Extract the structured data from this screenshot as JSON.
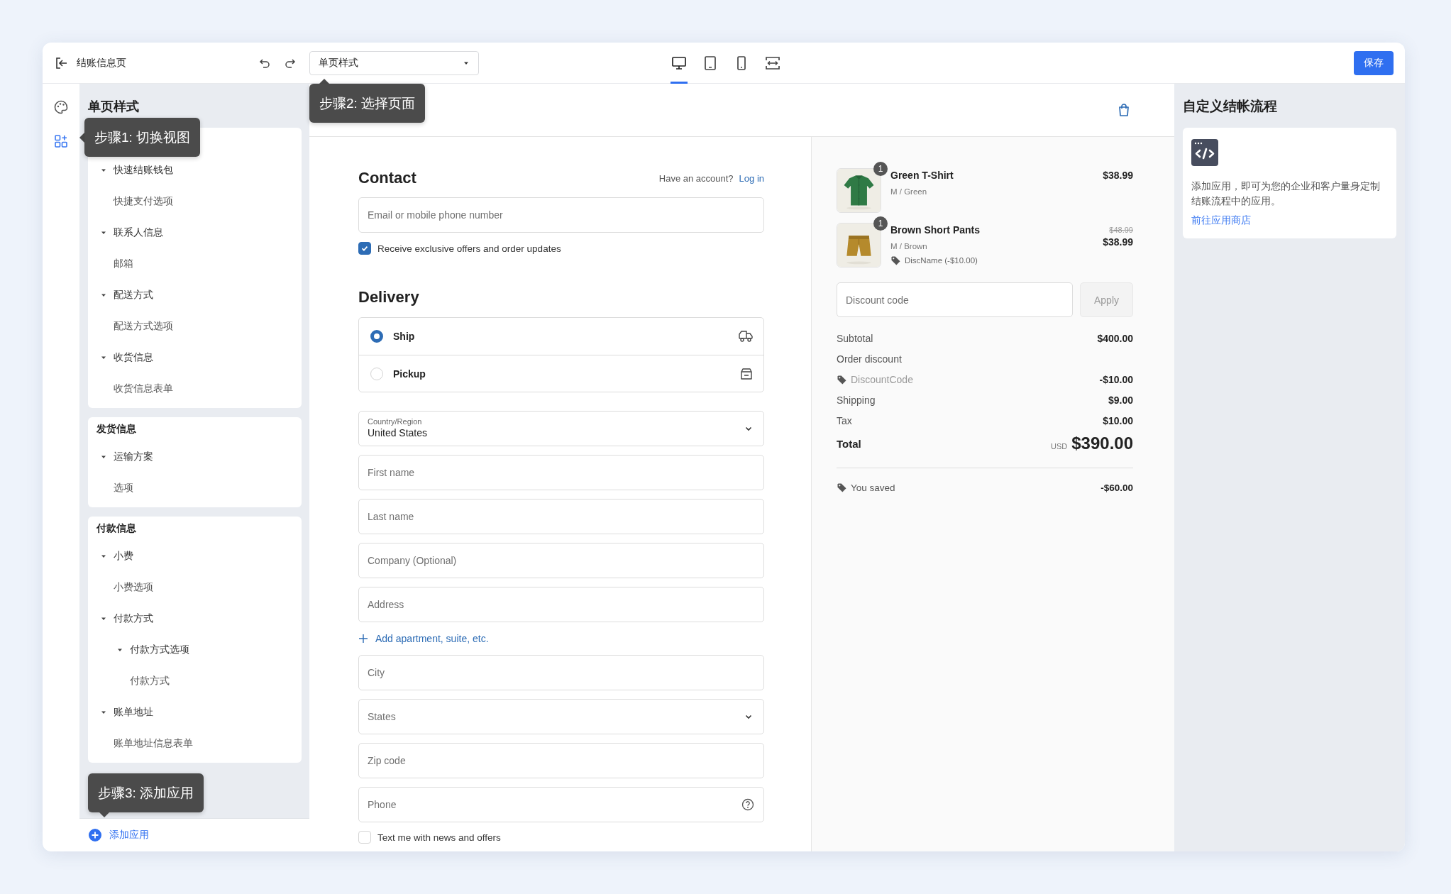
{
  "top_bar": {
    "title": "结账信息页",
    "page_select": "单页样式",
    "devices": [
      {
        "kind": "desktop",
        "selected": true
      },
      {
        "kind": "tablet",
        "selected": false
      },
      {
        "kind": "phone",
        "selected": false
      },
      {
        "kind": "fit",
        "selected": false
      }
    ],
    "save": "保存"
  },
  "rail": [
    {
      "kind": "palette",
      "selected": false
    },
    {
      "kind": "apps",
      "selected": true
    }
  ],
  "sidebar": {
    "title": "单页样式",
    "sections": [
      {
        "items": [
          {
            "label": "快速结账钱包",
            "expanded": true,
            "children": [
              {
                "label": "快捷支付选项"
              }
            ]
          },
          {
            "label": "联系人信息",
            "expanded": true,
            "children": [
              {
                "label": "邮箱"
              }
            ]
          },
          {
            "label": "配送方式",
            "expanded": true,
            "children": [
              {
                "label": "配送方式选项"
              }
            ]
          },
          {
            "label": "收货信息",
            "expanded": true,
            "children": [
              {
                "label": "收货信息表单"
              }
            ]
          }
        ]
      },
      {
        "heading": "发货信息",
        "items": [
          {
            "label": "运输方案",
            "expanded": true,
            "children": [
              {
                "label": "选项"
              }
            ]
          }
        ]
      },
      {
        "heading": "付款信息",
        "items": [
          {
            "label": "小费",
            "expanded": true,
            "children": [
              {
                "label": "小费选项"
              }
            ]
          },
          {
            "label": "付款方式",
            "expanded": true,
            "children": [
              {
                "label": "付款方式选项",
                "expanded": true,
                "children": [
                  {
                    "label": "付款方式"
                  }
                ]
              }
            ]
          },
          {
            "label": "账单地址",
            "expanded": true,
            "children": [
              {
                "label": "账单地址信息表单"
              }
            ]
          }
        ]
      }
    ],
    "add_app": "添加应用"
  },
  "tooltips": [
    {
      "text": "步骤1: 切换视图"
    },
    {
      "text": "步骤2: 选择页面"
    },
    {
      "text": "步骤3: 添加应用"
    }
  ],
  "checkout": {
    "contact": {
      "heading": "Contact",
      "account_prompt": "Have an account?",
      "login": "Log in",
      "email_placeholder": "Email or mobile phone number",
      "offers": {
        "label": "Receive exclusive offers and order updates",
        "checked": true
      }
    },
    "delivery": {
      "heading": "Delivery",
      "options": [
        {
          "label": "Ship",
          "kind": "truck",
          "selected": true
        },
        {
          "label": "Pickup",
          "kind": "store",
          "selected": false
        }
      ]
    },
    "fields": [
      {
        "kind": "select",
        "label": "Country/Region",
        "value": "United States"
      },
      {
        "kind": "text",
        "placeholder": "First name"
      },
      {
        "kind": "text",
        "placeholder": "Last name"
      },
      {
        "kind": "text",
        "placeholder": "Company (Optional)"
      },
      {
        "kind": "text",
        "placeholder": "Address"
      },
      {
        "kind": "link",
        "label": "Add apartment, suite, etc."
      },
      {
        "kind": "text",
        "placeholder": "City"
      },
      {
        "kind": "select",
        "placeholder": "States"
      },
      {
        "kind": "text",
        "placeholder": "Zip code"
      },
      {
        "kind": "help",
        "placeholder": "Phone"
      }
    ],
    "sms": {
      "label": "Text me with news and offers",
      "checked": false
    }
  },
  "summary": {
    "items": [
      {
        "name": "Green T-Shirt",
        "variant": "M / Green",
        "quantity": "1",
        "price": "$38.99"
      },
      {
        "name": "Brown Short Pants",
        "variant": "M / Brown",
        "quantity": "1",
        "compare_price": "$48.99",
        "price": "$38.99",
        "discount": "DiscName (-$10.00)"
      }
    ],
    "discount_placeholder": "Discount code",
    "apply": "Apply",
    "lines": [
      {
        "kind": "plain",
        "label": "Subtotal",
        "value": "$400.00"
      },
      {
        "kind": "plain",
        "label": "Order discount"
      },
      {
        "kind": "code",
        "label": "DiscountCode",
        "value": "-$10.00"
      },
      {
        "kind": "plain",
        "label": "Shipping",
        "value": "$9.00"
      },
      {
        "kind": "plain",
        "label": "Tax",
        "value": "$10.00"
      }
    ],
    "total": {
      "label": "Total",
      "currency": "USD",
      "value": "$390.00"
    },
    "saved": {
      "label": "You saved",
      "value": "-$60.00"
    }
  },
  "apps_panel": {
    "title": "自定义结帐流程",
    "body": "添加应用，即可为您的企业和客户量身定制结账流程中的应用。",
    "link": "前往应用商店"
  }
}
